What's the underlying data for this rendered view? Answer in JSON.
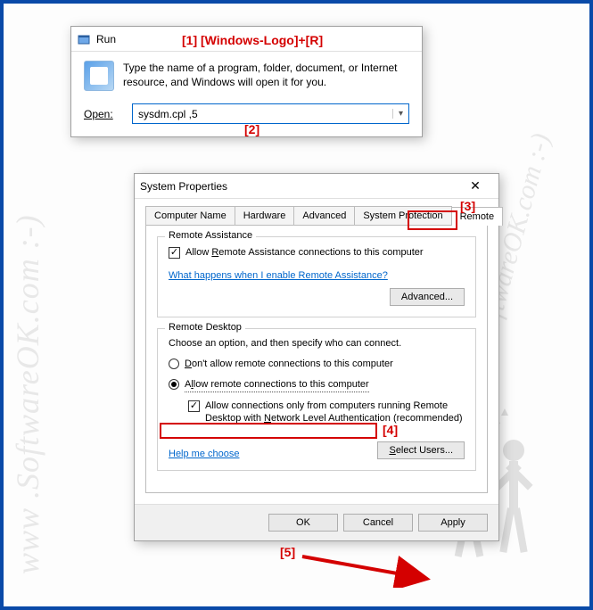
{
  "annotations": {
    "a1": "[1]  [Windows-Logo]+[R]",
    "a2": "[2]",
    "a3": "[3]",
    "a4": "[4]",
    "a5": "[5]"
  },
  "watermark": {
    "side": "www .SoftwareOK.com :-)",
    "diag": ".SoftwareOK.com :-)",
    "center": "www .SoftwareOK.com :-)"
  },
  "run": {
    "title": "Run",
    "description": "Type the name of a program, folder, document, or Internet resource, and Windows will open it for you.",
    "open_label": "Open:",
    "open_value": "sysdm.cpl ,5"
  },
  "sysprop": {
    "title": "System Properties",
    "tabs": {
      "computer_name": "Computer Name",
      "hardware": "Hardware",
      "advanced": "Advanced",
      "system_protection": "System Protection",
      "remote": "Remote"
    },
    "remote_assistance": {
      "group_title": "Remote Assistance",
      "allow_label_pre": "Allow ",
      "allow_label_u": "R",
      "allow_label_post": "emote Assistance connections to this computer",
      "what_happens": "What happens when I enable Remote Assistance?",
      "advanced_btn": "Advanced..."
    },
    "remote_desktop": {
      "group_title": "Remote Desktop",
      "choose": "Choose an option, and then specify who can connect.",
      "dont_allow_u": "D",
      "dont_allow_post": "on't allow remote connections to this computer",
      "allow_pre": "A",
      "allow_u": "l",
      "allow_post": "low remote connections to this computer",
      "nla_pre": "Allow connections only from computers running Remote Desktop with ",
      "nla_u": "N",
      "nla_post": "etwork Level Authentication (recommended)",
      "help": "Help me choose",
      "select_users_u": "S",
      "select_users_post": "elect Users..."
    },
    "buttons": {
      "ok": "OK",
      "cancel": "Cancel",
      "apply": "Apply"
    },
    "close_glyph": "✕"
  }
}
